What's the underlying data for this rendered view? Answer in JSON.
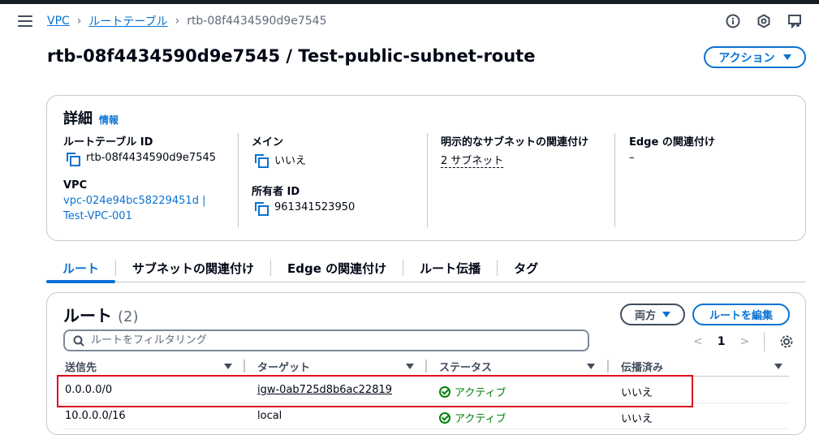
{
  "breadcrumb": {
    "items": [
      "VPC",
      "ルートテーブル"
    ],
    "current": "rtb-08f4434590d9e7545"
  },
  "top_icons": [
    "info-icon",
    "hexagon-icon",
    "feedback-icon"
  ],
  "page": {
    "title": "rtb-08f4434590d9e7545 / Test-public-subnet-route",
    "action_label": "アクション"
  },
  "details": {
    "title": "詳細",
    "info_label": "情報",
    "route_table_id_label": "ルートテーブル ID",
    "route_table_id": "rtb-08f4434590d9e7545",
    "vpc_label": "VPC",
    "vpc_line1": "vpc-024e94bc58229451d |",
    "vpc_line2": "Test-VPC-001",
    "main_label": "メイン",
    "main_value": "いいえ",
    "owner_label": "所有者 ID",
    "owner_value": "961341523950",
    "explicit_label": "明示的なサブネットの関連付け",
    "explicit_value": "2 サブネット",
    "edge_label": "Edge の関連付け",
    "edge_value": "–"
  },
  "tabs": [
    "ルート",
    "サブネットの関連付け",
    "Edge の関連付け",
    "ルート伝播",
    "タグ"
  ],
  "routes": {
    "title": "ルート",
    "count": "(2)",
    "both_label": "両方",
    "edit_label": "ルートを編集",
    "filter_placeholder": "ルートをフィルタリング",
    "page": "1",
    "columns": [
      "送信先",
      "ターゲット",
      "ステータス",
      "伝播済み"
    ],
    "rows": [
      {
        "destination": "0.0.0.0/0",
        "target": "igw-0ab725d8b6ac22819",
        "status": "アクティブ",
        "propagated": "いいえ"
      },
      {
        "destination": "10.0.0.0/16",
        "target": "local",
        "status": "アクティブ",
        "propagated": "いいえ"
      }
    ]
  },
  "colors": {
    "link": "#0972d3",
    "active": "#037f0c",
    "highlight": "#e0051f"
  }
}
